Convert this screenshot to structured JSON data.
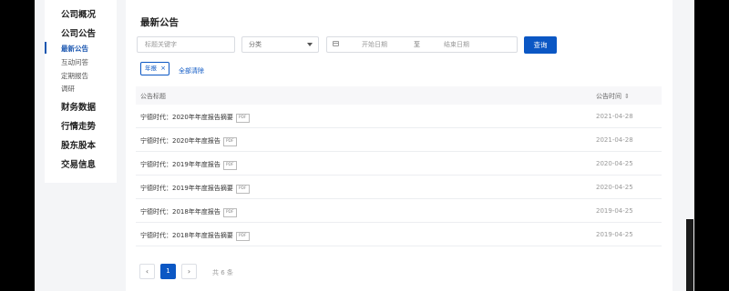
{
  "sidebar": {
    "items": [
      {
        "label": "公司概况"
      },
      {
        "label": "公司公告"
      },
      {
        "label": "财务数据"
      },
      {
        "label": "行情走势"
      },
      {
        "label": "股东股本"
      },
      {
        "label": "交易信息"
      }
    ],
    "subitems": [
      {
        "label": "最新公告",
        "active": true
      },
      {
        "label": "互动问答"
      },
      {
        "label": "定期报告"
      },
      {
        "label": "调研"
      }
    ]
  },
  "main": {
    "title": "最新公告",
    "filters": {
      "keyword_placeholder": "标题关键字",
      "keyword_value": "",
      "category": "分类",
      "start_date": "开始日期",
      "to": "至",
      "end_date": "结束日期",
      "query_label": "查询"
    },
    "tag": {
      "label": "年报",
      "close": "×"
    },
    "clear_all": "全部清除",
    "table": {
      "headers": [
        "公告标题",
        "公告时间"
      ],
      "rows": [
        {
          "title": "宁德时代：2020年年度报告摘要",
          "badge": "PDF",
          "date": "2021-04-28"
        },
        {
          "title": "宁德时代：2020年年度报告",
          "badge": "PDF",
          "date": "2021-04-28"
        },
        {
          "title": "宁德时代：2019年年度报告",
          "badge": "PDF",
          "date": "2020-04-25"
        },
        {
          "title": "宁德时代：2019年年度报告摘要",
          "badge": "PDF",
          "date": "2020-04-25"
        },
        {
          "title": "宁德时代：2018年年度报告",
          "badge": "PDF",
          "date": "2019-04-25"
        },
        {
          "title": "宁德时代：2018年年度报告摘要",
          "badge": "PDF",
          "date": "2019-04-25"
        }
      ]
    },
    "pagination": {
      "prev": "‹",
      "current": "1",
      "next": "›",
      "total": "共 6 条"
    }
  },
  "icons": {
    "calendar": "calendar-icon",
    "sort": "sort-icon",
    "caret": "chevron-down-icon"
  },
  "colors": {
    "accent": "#0b57c4",
    "background": "#f4f5f7"
  }
}
